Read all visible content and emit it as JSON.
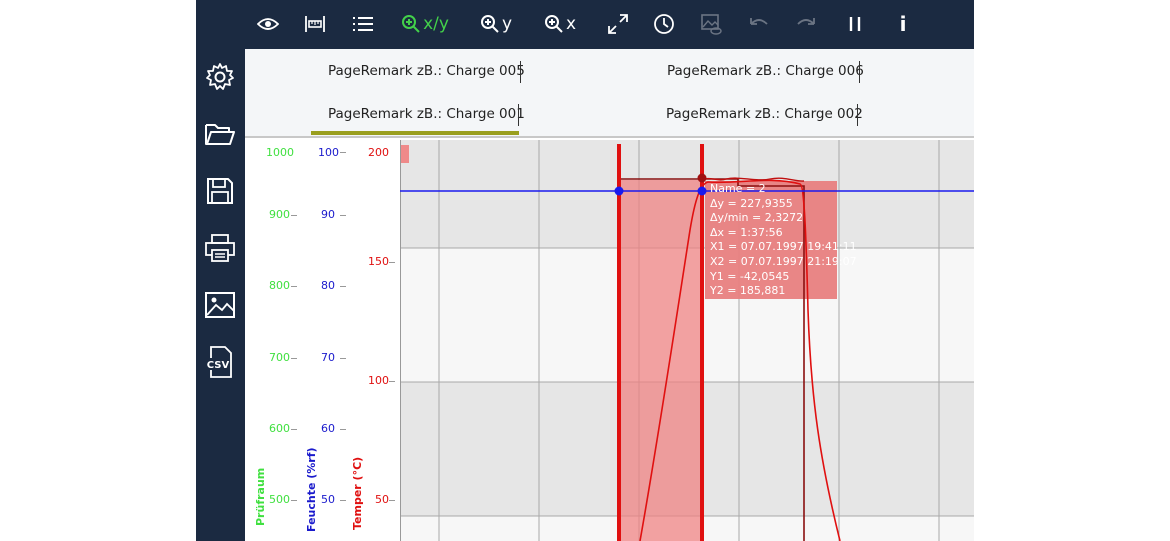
{
  "toolbar": {
    "zoom_xy_label": "x/y",
    "zoom_y_label": "y",
    "zoom_x_label": "x",
    "info_label": "i"
  },
  "tabs": [
    {
      "label": "PageRemark zB.: Charge 005"
    },
    {
      "label": "PageRemark zB.: Charge 006"
    },
    {
      "label": "PageRemark zB.: Charge 001",
      "active": true
    },
    {
      "label": "PageRemark zB.: Charge 002"
    }
  ],
  "axes": {
    "pruefraum": {
      "title": "Prüfraum",
      "color": "#40e040",
      "ticks": [
        "1000",
        "900",
        "800",
        "700",
        "600",
        "500"
      ]
    },
    "feuchte": {
      "title": "Feuchte (%rf)",
      "color": "#1a1acc",
      "ticks": [
        "100",
        "90",
        "80",
        "70",
        "60",
        "50"
      ]
    },
    "temper": {
      "title": "Temper (°C)",
      "color": "#e01010",
      "ticks": [
        "200",
        "150",
        "100",
        "50"
      ]
    }
  },
  "tooltip": {
    "name": "Name = 2",
    "dy": "Δy = 227,9355",
    "dy_min": "Δy/min = 2,3272",
    "dx": "Δx = 1:37:56",
    "x1": "X1 = 07.07.1997 19:41:11",
    "x2": "X2 = 07.07.1997 21:19:07",
    "y1": "Y1 = -42,0545",
    "y2": "Y2 = 185,881"
  },
  "icons": {
    "toolbar": [
      "eye-icon",
      "ruler-icon",
      "list-icon",
      "zoom-in-icon",
      "zoom-in-icon",
      "zoom-in-icon",
      "expand-icon",
      "clock-icon",
      "image-eye-icon",
      "undo-icon",
      "redo-icon",
      "pause-icon",
      "info-icon"
    ],
    "sidebar": [
      "gear-icon",
      "folder-open-icon",
      "save-icon",
      "print-icon",
      "image-icon",
      "csv-icon"
    ]
  },
  "colors": {
    "toolbar_bg": "#1b2a41",
    "accent_underline": "#9a9f1f",
    "cursor_red": "#e01010",
    "measure_fill": "#f08080",
    "horizontal_line": "#1a1aee"
  }
}
